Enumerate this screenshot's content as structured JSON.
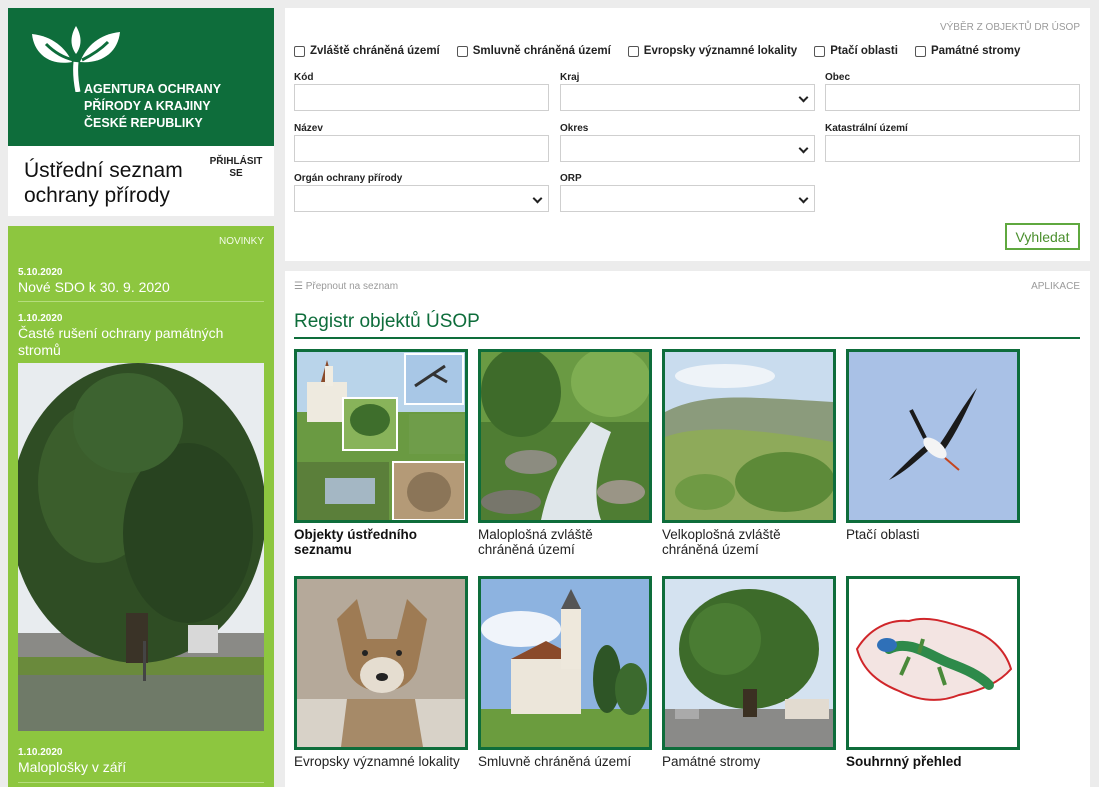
{
  "agency": {
    "logo_lines": [
      "AGENTURA OCHRANY",
      "PŘÍRODY A KRAJINY",
      "ČESKÉ REPUBLIKY"
    ]
  },
  "site": {
    "title_line1": "Ústřední seznam",
    "title_line2": "ochrany přírody",
    "login_line1": "PŘIHLÁSIT",
    "login_line2": "SE"
  },
  "news": {
    "heading": "NOVINKY",
    "items": [
      {
        "date": "5.10.2020",
        "title": "Nové SDO k 30. 9. 2020"
      },
      {
        "date": "1.10.2020",
        "title": "Časté rušení ochrany památných stromů"
      },
      {
        "date": "1.10.2020",
        "title": "Maloplošky v září"
      }
    ]
  },
  "search": {
    "heading": "VÝBĚR Z OBJEKTŮ DR ÚSOP",
    "checkboxes": [
      "Zvláště chráněná území",
      "Smluvně chráněná území",
      "Evropsky významné lokality",
      "Ptačí oblasti",
      "Památné stromy"
    ],
    "fields": {
      "kod": "Kód",
      "kraj": "Kraj",
      "obec": "Obec",
      "nazev": "Název",
      "okres": "Okres",
      "katastr": "Katastrální území",
      "organ": "Orgán ochrany přírody",
      "orp": "ORP"
    },
    "button": "Vyhledat"
  },
  "registry": {
    "switch_label": "Přepnout na seznam",
    "apps_label": "APLIKACE",
    "title": "Registr objektů ÚSOP",
    "tiles": [
      {
        "line1": "Objekty ústředního",
        "line2": "seznamu"
      },
      {
        "line1": "Maloplošná zvláště",
        "line2": "chráněná území"
      },
      {
        "line1": "Velkoplošná zvláště",
        "line2": "chráněná území"
      },
      {
        "line1": "Ptačí oblasti",
        "line2": ""
      },
      {
        "line1": "Evropsky významné lokality",
        "line2": ""
      },
      {
        "line1": "Smluvně chráněná území",
        "line2": ""
      },
      {
        "line1": "Památné stromy",
        "line2": ""
      },
      {
        "line1": "Souhrnný přehled",
        "line2": ""
      }
    ]
  },
  "colors": {
    "brand_green": "#0e6d3b",
    "news_green": "#8dc63f",
    "button_green": "#5fa83f"
  }
}
